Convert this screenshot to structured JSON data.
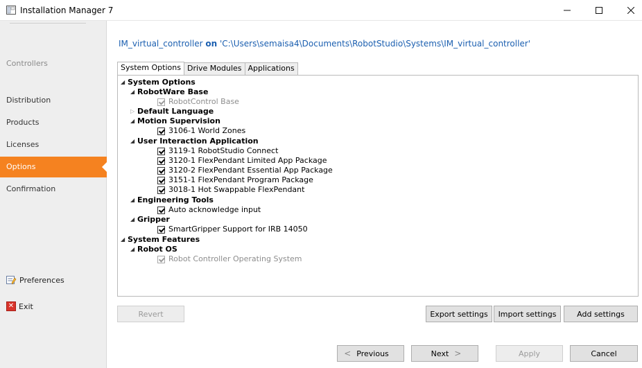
{
  "window": {
    "title": "Installation Manager 7",
    "controls": {
      "minimize": "—",
      "maximize": "☐",
      "close": "✕"
    }
  },
  "sidebar": {
    "items": [
      {
        "label": "Controllers",
        "state": "disabled"
      },
      {
        "label": "Distribution",
        "state": "normal"
      },
      {
        "label": "Products",
        "state": "normal"
      },
      {
        "label": "Licenses",
        "state": "normal"
      },
      {
        "label": "Options",
        "state": "active"
      },
      {
        "label": "Confirmation",
        "state": "normal"
      }
    ],
    "preferences_label": "Preferences",
    "exit_label": "Exit",
    "active_color": "#f58220"
  },
  "header": {
    "controller": "IM_virtual_controller",
    "on": "on",
    "path": "'C:\\Users\\semaisa4\\Documents\\RobotStudio\\Systems\\IM_virtual_controller'"
  },
  "tabs": [
    "System Options",
    "Drive Modules",
    "Applications"
  ],
  "tree": {
    "system_options": "System Options",
    "robotware_base": "RobotWare Base",
    "robotcontrol_base": "RobotControl Base",
    "default_language": "Default Language",
    "motion_supervision": "Motion Supervision",
    "world_zones": "3106-1 World Zones",
    "user_interaction": "User Interaction Application",
    "ui_items": [
      "3119-1 RobotStudio Connect",
      "3120-1 FlexPendant Limited App Package",
      "3120-2 FlexPendant Essential App Package",
      "3151-1 FlexPendant Program Package",
      "3018-1 Hot Swappable FlexPendant"
    ],
    "engineering_tools": "Engineering Tools",
    "auto_ack": "Auto acknowledge input",
    "gripper": "Gripper",
    "smartgripper": "SmartGripper Support for IRB 14050",
    "system_features": "System Features",
    "robot_os": "Robot OS",
    "robot_os_item": "Robot Controller Operating System"
  },
  "buttons": {
    "revert": "Revert",
    "export": "Export settings",
    "import": "Import settings",
    "add": "Add settings",
    "previous": "Previous",
    "next": "Next",
    "apply": "Apply",
    "cancel": "Cancel"
  }
}
